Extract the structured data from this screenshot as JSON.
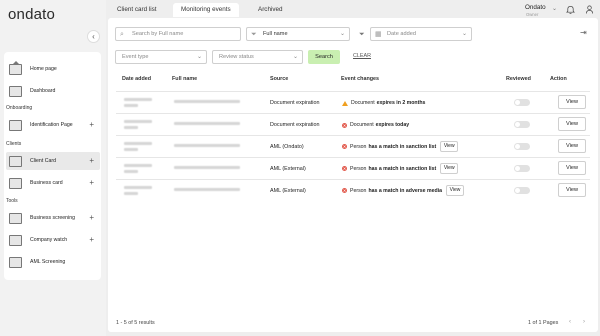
{
  "brand": {
    "logo_text": "ondato"
  },
  "sidebar": {
    "collapse_icon": "chevron-left-icon",
    "sections": {
      "onboarding": "Onboarding",
      "clients": "Clients",
      "tools": "Tools"
    },
    "items": [
      {
        "label": "Home page",
        "icon": "house-icon"
      },
      {
        "label": "Dashboard",
        "icon": "dashboard-icon"
      },
      {
        "label": "Identification Page",
        "icon": "id-card-icon"
      },
      {
        "label": "Client Card",
        "icon": "client-card-icon"
      },
      {
        "label": "Business card",
        "icon": "business-card-icon"
      },
      {
        "label": "Business screening",
        "icon": "business-screening-icon"
      },
      {
        "label": "Company watch",
        "icon": "company-watch-icon"
      },
      {
        "label": "AML Screening",
        "icon": "aml-screening-icon"
      }
    ]
  },
  "header": {
    "tabs": [
      "Client card list",
      "Monitoring events",
      "Archived"
    ],
    "active_tab": "Monitoring events",
    "user_name": "Ondato",
    "user_sub": "Owner"
  },
  "filters": {
    "search_placeholder": "Search by Full name",
    "name_select": "Full name",
    "date_placeholder": "Date added",
    "event_type_placeholder": "Event type",
    "review_status_placeholder": "Review status",
    "search_label": "Search",
    "clear_label": "CLEAR"
  },
  "table": {
    "columns": [
      "Date added",
      "Full name",
      "Source",
      "Event changes",
      "Reviewed",
      "Action"
    ],
    "view_label": "View",
    "rows": [
      {
        "source": "Document expiration",
        "status": "warning",
        "subject": "Document",
        "change": "expires in 2 months",
        "inline_view": false
      },
      {
        "source": "Document expiration",
        "status": "error",
        "subject": "Document",
        "change": "expires today",
        "inline_view": false
      },
      {
        "source": "AML (Ondato)",
        "status": "error",
        "subject": "Person",
        "change": "has a match in sanction list",
        "inline_view": true
      },
      {
        "source": "AML (External)",
        "status": "error",
        "subject": "Person",
        "change": "has a match in sanction list",
        "inline_view": true
      },
      {
        "source": "AML (External)",
        "status": "error",
        "subject": "Person",
        "change": "has a match in adverse media",
        "inline_view": true
      }
    ]
  },
  "footer": {
    "results": "1 - 5 of 5 results",
    "pages": "1 of 1 Pages"
  },
  "colors": {
    "accent": "#c9efb1",
    "error": "#e25a4d",
    "warning": "#f0a020"
  }
}
